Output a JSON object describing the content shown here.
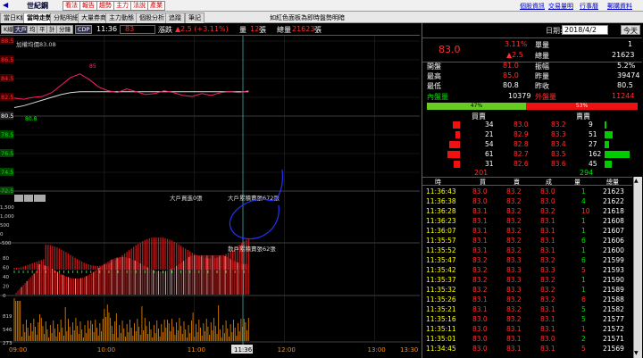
{
  "topbar": {
    "stock_name": "世紀鋼",
    "buttons": [
      "看法",
      "報告",
      "趨勢",
      "主力",
      "法說",
      "產業"
    ],
    "notice": "如紅色面板為即時盤勢明暗",
    "links": [
      "個股資訊",
      "交易量明",
      "行事曆",
      "郵購資料"
    ]
  },
  "tabs": [
    "當日K線",
    "當時走勢",
    "分點明細",
    "大量券商",
    "主力動態",
    "個股分析",
    "追蹤",
    "筆記"
  ],
  "controls": {
    "left_buttons": [
      "K線",
      "大戶",
      "均",
      "平",
      "計",
      "分鐘",
      "CDP"
    ],
    "time": "11:36",
    "last_price": "83",
    "change_label": "漲跌",
    "change": "▲2.5 (+3.11%)",
    "volume_label": "量",
    "volume": "12",
    "vol_unit": "張",
    "total_label": "總量",
    "total": "21623",
    "total_unit": "張"
  },
  "chart_data": {
    "type": "line",
    "price_axis": [
      "88.5",
      "86.5",
      "84.5",
      "82.5",
      "80.5",
      "78.5",
      "76.5",
      "74.5",
      "72.5"
    ],
    "ref_label": "加權均價",
    "avg_price": "83.08",
    "high_mark": "85",
    "low_mark": "80.8",
    "vol_axis": [
      "1,500",
      "1,000",
      "500",
      "0",
      "-500"
    ],
    "panel2_label": "大戶買進0張",
    "panel2_note": "大戶累積賣張672張",
    "panel3_note": "散戶累積賣張62張",
    "panel3_axis": [
      "80",
      "60",
      "40",
      "20",
      "0"
    ],
    "panel4_axis": [
      "819",
      "546",
      "273"
    ],
    "x_labels": [
      "09:00",
      "10:00",
      "11:00",
      "12:00",
      "13:00",
      "13:30"
    ],
    "cursor_time": "11:36",
    "price_series": [
      82.4,
      82.3,
      82.5,
      82.6,
      83.0,
      83.8,
      84.6,
      85.0,
      84.4,
      83.6,
      83.2,
      83.0,
      83.4,
      83.1,
      82.8,
      82.9,
      83.2,
      83.0,
      82.7,
      82.6,
      82.9,
      82.7,
      83.0,
      83.1,
      83.0,
      83.2
    ],
    "avg_series": [
      81.4,
      81.6,
      81.9,
      82.2,
      82.5,
      82.8,
      83.0,
      83.1,
      83.1,
      83.1,
      83.1,
      83.1,
      83.1,
      83.1,
      83.1,
      83.1,
      83.1,
      83.1,
      83.1,
      83.1,
      83.1,
      83.1,
      83.1,
      83.1,
      83.1,
      83.1
    ]
  },
  "quote": {
    "date_label": "日期:",
    "date": "2018/4/2",
    "today": "今天",
    "price": "83.0",
    "pct": "3.11%",
    "chg": "▲2.5",
    "unit_label": "單量",
    "unit": "1",
    "total_label": "總量",
    "total": "21623",
    "rows": [
      {
        "l": "開盤",
        "v": "81.0",
        "l2": "振幅",
        "v2": "5.2%"
      },
      {
        "l": "最高",
        "v": "85.0",
        "l2": "昨量",
        "v2": "39474"
      },
      {
        "l": "最低",
        "v": "80.8",
        "l2": "昨收",
        "v2": "80.5"
      }
    ],
    "inner_label": "內盤量",
    "inner": "10379",
    "outer_label": "外盤量",
    "outer": "11244",
    "inner_pct": "47%",
    "outer_pct": "53%",
    "buy_header": "買賣",
    "sell_header": "賣賣",
    "book": [
      {
        "bv": "34",
        "bp": "83.0",
        "sp": "83.2",
        "sv": "9"
      },
      {
        "bv": "21",
        "bp": "82.9",
        "sp": "83.3",
        "sv": "51"
      },
      {
        "bv": "54",
        "bp": "82.8",
        "sp": "83.4",
        "sv": "27"
      },
      {
        "bv": "61",
        "bp": "82.7",
        "sp": "83.5",
        "sv": "162"
      },
      {
        "bv": "31",
        "bp": "82.6",
        "sp": "83.6",
        "sv": "45"
      }
    ],
    "book_tot_buy": "201",
    "book_tot_sell": "294",
    "tick_headers": [
      "時",
      "買",
      "賣",
      "成",
      "量",
      "總量"
    ],
    "ticks": [
      [
        "11:36:43",
        "83.0",
        "83.2",
        "83.0",
        "1",
        "21623"
      ],
      [
        "11:36:38",
        "83.0",
        "83.2",
        "83.0",
        "4",
        "21622"
      ],
      [
        "11:36:28",
        "83.1",
        "83.2",
        "83.2",
        "10",
        "21618"
      ],
      [
        "11:36:23",
        "83.1",
        "83.2",
        "83.1",
        "1",
        "21608"
      ],
      [
        "11:36:07",
        "83.1",
        "83.2",
        "83.1",
        "1",
        "21607"
      ],
      [
        "11:35:57",
        "83.1",
        "83.2",
        "83.1",
        "6",
        "21606"
      ],
      [
        "11:35:52",
        "83.1",
        "83.2",
        "83.1",
        "1",
        "21600"
      ],
      [
        "11:35:47",
        "83.2",
        "83.3",
        "83.2",
        "6",
        "21599"
      ],
      [
        "11:35:42",
        "83.2",
        "83.3",
        "83.3",
        "5",
        "21593"
      ],
      [
        "11:35:37",
        "83.2",
        "83.3",
        "83.2",
        "1",
        "21590"
      ],
      [
        "11:35:32",
        "83.2",
        "83.3",
        "83.2",
        "1",
        "21589"
      ],
      [
        "11:35:26",
        "83.1",
        "83.2",
        "83.2",
        "6",
        "21588"
      ],
      [
        "11:35:21",
        "83.1",
        "83.2",
        "83.1",
        "5",
        "21582"
      ],
      [
        "11:35:16",
        "83.0",
        "83.2",
        "83.1",
        "5",
        "21577"
      ],
      [
        "11:35:11",
        "83.0",
        "83.1",
        "83.1",
        "1",
        "21572"
      ],
      [
        "11:35:01",
        "83.0",
        "83.1",
        "83.0",
        "2",
        "21571"
      ],
      [
        "11:34:45",
        "83.0",
        "83.1",
        "83.1",
        "5",
        "21569"
      ]
    ]
  }
}
